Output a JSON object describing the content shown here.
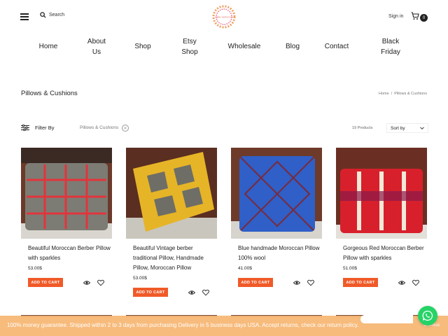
{
  "header": {
    "search_label": "Search",
    "logo_text": "SIMPLY MOROCCAN",
    "signin_label": "Sign in",
    "cart_count": "0"
  },
  "nav": [
    {
      "label": "Home"
    },
    {
      "label": "About\nUs"
    },
    {
      "label": "Shop"
    },
    {
      "label": "Etsy\nShop"
    },
    {
      "label": "Wholesale"
    },
    {
      "label": "Blog"
    },
    {
      "label": "Contact"
    },
    {
      "label": "Black\nFriday"
    }
  ],
  "page": {
    "title": "Pillows & Cushions",
    "breadcrumb": [
      "Home",
      "/",
      "Pillows & Cushions"
    ]
  },
  "filters": {
    "filter_label": "Filter By",
    "active_filter": "Pillows & Cushions",
    "product_count": "19 Products",
    "sort_label": "Sort by"
  },
  "products": [
    {
      "name": "Beautiful Moroccan Berber Pillow with sparkles",
      "price": "53.00$",
      "button": "ADD TO CART",
      "palette": {
        "bg": "#6b3a2a",
        "main": "#7c7c74",
        "accent": "#e3343c",
        "floor": "#d9d6cf"
      }
    },
    {
      "name": "Beautiful Vintage berber traditional Pillow, Handmade Pillow, Moroccan Pillow",
      "price": "53.00$",
      "button": "ADD TO CART",
      "palette": {
        "bg": "#5b2e22",
        "main": "#e6b427",
        "accent": "#6e6e66",
        "floor": "#c9c6bd"
      }
    },
    {
      "name": "Blue handmade Moroccan Pillow 100% wool",
      "price": "41.00$",
      "button": "ADD TO CART",
      "palette": {
        "bg": "#6e3a2a",
        "main": "#2f5fc7",
        "accent": "#7a2a3a",
        "floor": "#d7d4cd"
      }
    },
    {
      "name": "Gorgeous Red Moroccan Berber Pillow with sparkles",
      "price": "51.00$",
      "button": "ADD TO CART",
      "palette": {
        "bg": "#6a2f22",
        "main": "#d8202c",
        "accent": "#f2e9d8",
        "floor": "#e3e0d9"
      }
    }
  ],
  "banner": {
    "text": "100% money guarantee. Shipped within 2 to 3 days from purchasing Delivery in 5 business days USA. Accept returns, check our return policy.",
    "close_label": "Dismiss"
  },
  "colors": {
    "accent": "#f05a28",
    "banner": "#f7b876",
    "whatsapp": "#25d366"
  }
}
